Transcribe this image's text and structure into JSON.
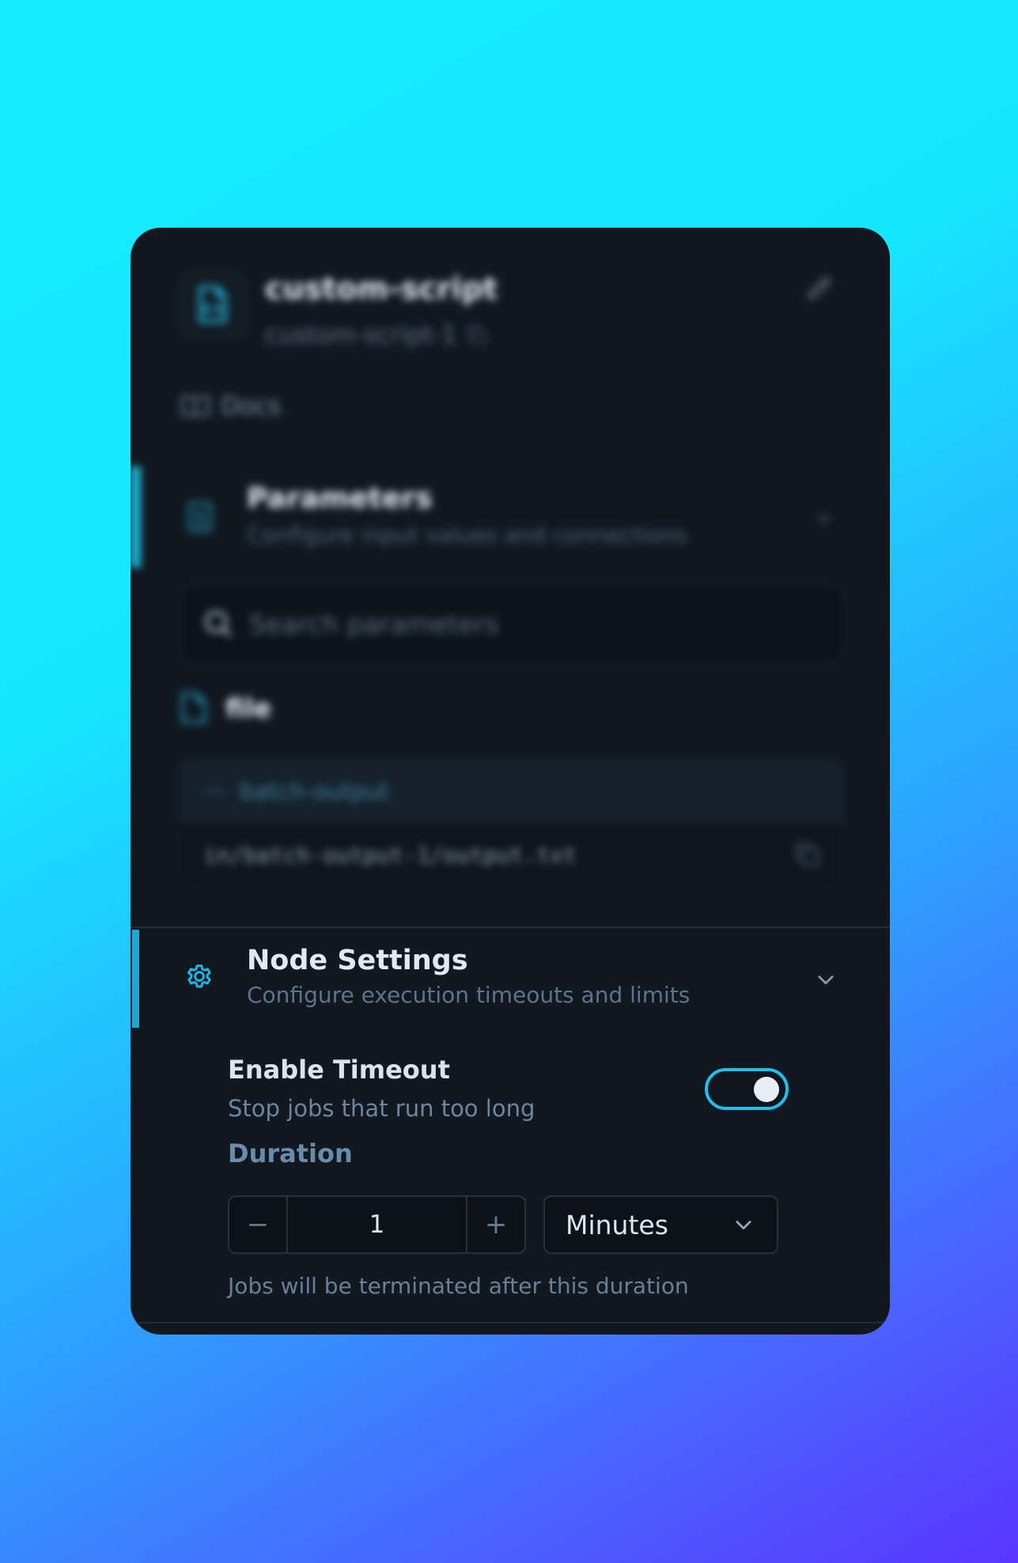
{
  "node": {
    "title": "custom-script",
    "id": "custom-script-1",
    "docs_label": "Docs"
  },
  "parameters": {
    "title": "Parameters",
    "subtitle": "Configure input values and connections",
    "search_placeholder": "Search parameters",
    "file_label": "file",
    "connection_name": "batch-output",
    "connection_path": "in/batch-output-1/output.txt"
  },
  "node_settings": {
    "title": "Node Settings",
    "subtitle": "Configure execution timeouts and limits",
    "enable_timeout_label": "Enable Timeout",
    "enable_timeout_description": "Stop jobs that run too long",
    "timeout_enabled": true,
    "duration_label": "Duration",
    "decrement_label": "−",
    "duration_value": "1",
    "increment_label": "+",
    "unit_value": "Minutes",
    "hint": "Jobs will be terminated after this duration"
  },
  "colors": {
    "accent": "#1fbfee",
    "panel_bg": "#111820"
  }
}
